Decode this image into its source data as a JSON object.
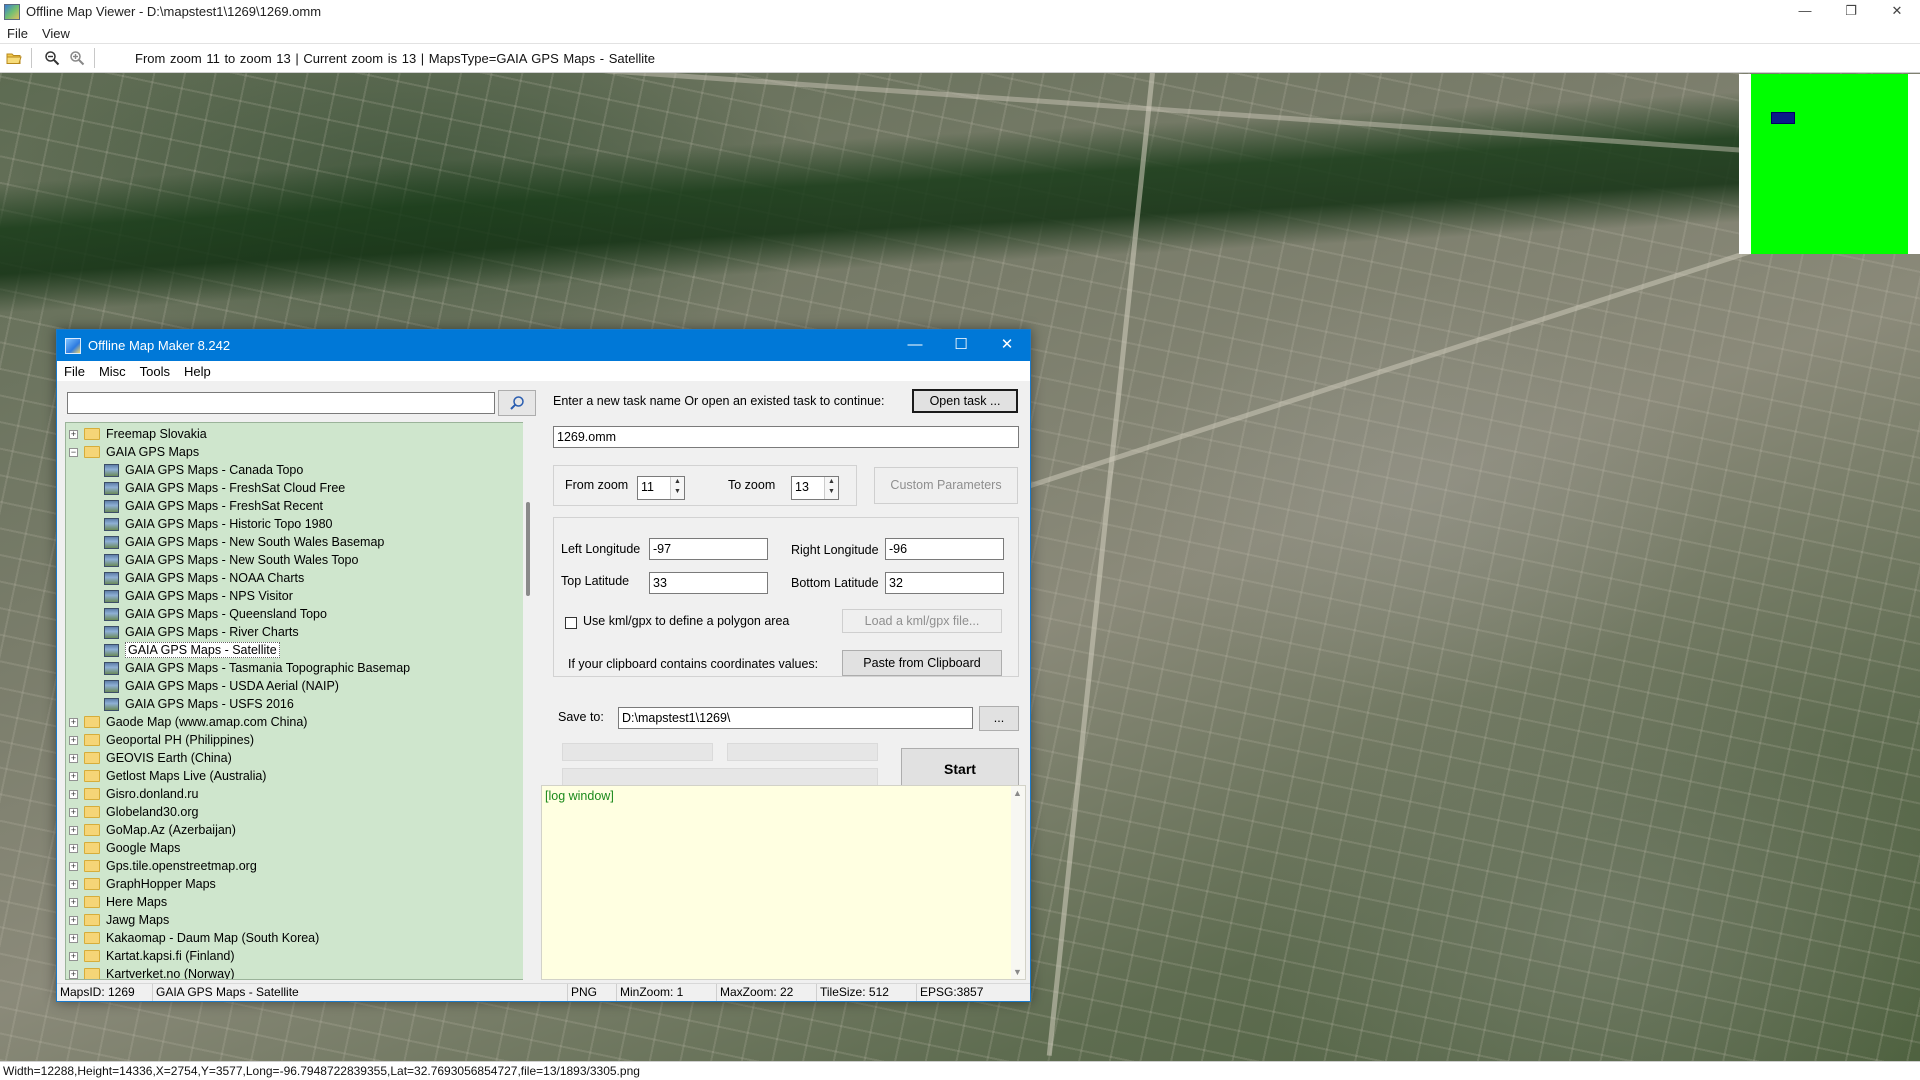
{
  "window": {
    "title": "Offline Map Viewer - D:\\mapstest1\\1269\\1269.omm",
    "controls": [
      "—",
      "❐",
      "✕"
    ]
  },
  "menu": [
    "File",
    "View"
  ],
  "toolbar": {
    "info": "From zoom 11 to zoom 13   |   Current zoom is 13 |   MapsType=GAIA GPS Maps - Satellite"
  },
  "status_bar": "Width=12288,Height=14336,X=2754,Y=3577,Long=-96.7948722839355,Lat=32.7693056854727,file=13/1893/3305.png",
  "dialog": {
    "title": "Offline Map Maker 8.242",
    "controls": [
      "—",
      "☐",
      "✕"
    ],
    "menu": [
      "File",
      "Misc",
      "Tools",
      "Help"
    ],
    "search_value": "",
    "tree": [
      {
        "type": "folder",
        "label": "Freemap Slovakia",
        "exp": "+"
      },
      {
        "type": "folder-open",
        "label": "GAIA GPS Maps",
        "exp": "−"
      },
      {
        "type": "map",
        "label": "GAIA GPS Maps - Canada Topo"
      },
      {
        "type": "map",
        "label": "GAIA GPS Maps - FreshSat Cloud Free"
      },
      {
        "type": "map",
        "label": "GAIA GPS Maps - FreshSat Recent"
      },
      {
        "type": "map",
        "label": "GAIA GPS Maps - Historic Topo 1980"
      },
      {
        "type": "map",
        "label": "GAIA GPS Maps - New South Wales Basemap"
      },
      {
        "type": "map",
        "label": "GAIA GPS Maps - New South Wales Topo"
      },
      {
        "type": "map",
        "label": "GAIA GPS Maps - NOAA Charts"
      },
      {
        "type": "map",
        "label": "GAIA GPS Maps - NPS Visitor"
      },
      {
        "type": "map",
        "label": "GAIA GPS Maps - Queensland Topo"
      },
      {
        "type": "map",
        "label": "GAIA GPS Maps - River Charts"
      },
      {
        "type": "map",
        "label": "GAIA GPS Maps - Satellite",
        "selected": true
      },
      {
        "type": "map",
        "label": "GAIA GPS Maps - Tasmania Topographic Basemap"
      },
      {
        "type": "map",
        "label": "GAIA GPS Maps - USDA Aerial (NAIP)"
      },
      {
        "type": "map",
        "label": "GAIA GPS Maps - USFS 2016"
      },
      {
        "type": "folder",
        "label": "Gaode Map (www.amap.com China)",
        "exp": "+"
      },
      {
        "type": "folder",
        "label": "Geoportal PH (Philippines)",
        "exp": "+"
      },
      {
        "type": "folder",
        "label": "GEOVIS Earth (China)",
        "exp": "+"
      },
      {
        "type": "folder",
        "label": "Getlost Maps Live (Australia)",
        "exp": "+"
      },
      {
        "type": "folder",
        "label": "Gisro.donland.ru",
        "exp": "+"
      },
      {
        "type": "folder",
        "label": "Globeland30.org",
        "exp": "+"
      },
      {
        "type": "folder",
        "label": "GoMap.Az (Azerbaijan)",
        "exp": "+"
      },
      {
        "type": "folder",
        "label": "Google Maps",
        "exp": "+"
      },
      {
        "type": "folder",
        "label": "Gps.tile.openstreetmap.org",
        "exp": "+"
      },
      {
        "type": "folder",
        "label": "GraphHopper Maps",
        "exp": "+"
      },
      {
        "type": "folder",
        "label": "Here Maps",
        "exp": "+"
      },
      {
        "type": "folder",
        "label": "Jawg Maps",
        "exp": "+"
      },
      {
        "type": "folder",
        "label": "Kakaomap - Daum Map (South Korea)",
        "exp": "+"
      },
      {
        "type": "folder",
        "label": "Kartat.kapsi.fi (Finland)",
        "exp": "+"
      },
      {
        "type": "folder",
        "label": "Kartverket.no (Norway)",
        "exp": "+"
      }
    ],
    "task_prompt": "Enter a new task name Or open an existed task to continue:",
    "open_task_label": "Open task ...",
    "task_name": "1269.omm",
    "from_zoom_label": "From zoom",
    "from_zoom": "11",
    "to_zoom_label": "To zoom",
    "to_zoom": "13",
    "custom_params_label": "Custom Parameters",
    "left_lon_label": "Left Longitude",
    "left_lon": "-97",
    "right_lon_label": "Right Longitude",
    "right_lon": "-96",
    "top_lat_label": "Top Latitude",
    "top_lat": "33",
    "bottom_lat_label": "Bottom Latitude",
    "bottom_lat": "32",
    "kml_label": "Use kml/gpx to define a polygon area",
    "load_kml_label": "Load a kml/gpx file...",
    "clipboard_label": "If your clipboard contains coordinates values:",
    "paste_label": "Paste from Clipboard",
    "save_to_label": "Save to:",
    "save_to": "D:\\mapstest1\\1269\\",
    "browse_label": "...",
    "start_label": "Start",
    "log_text": "[log window]",
    "status": {
      "maps_id": "MapsID: 1269",
      "map_name": "GAIA GPS Maps - Satellite",
      "format": "PNG",
      "min_zoom": "MinZoom: 1",
      "max_zoom": "MaxZoom: 22",
      "tile_size": "TileSize: 512",
      "epsg": "EPSG:3857"
    }
  }
}
